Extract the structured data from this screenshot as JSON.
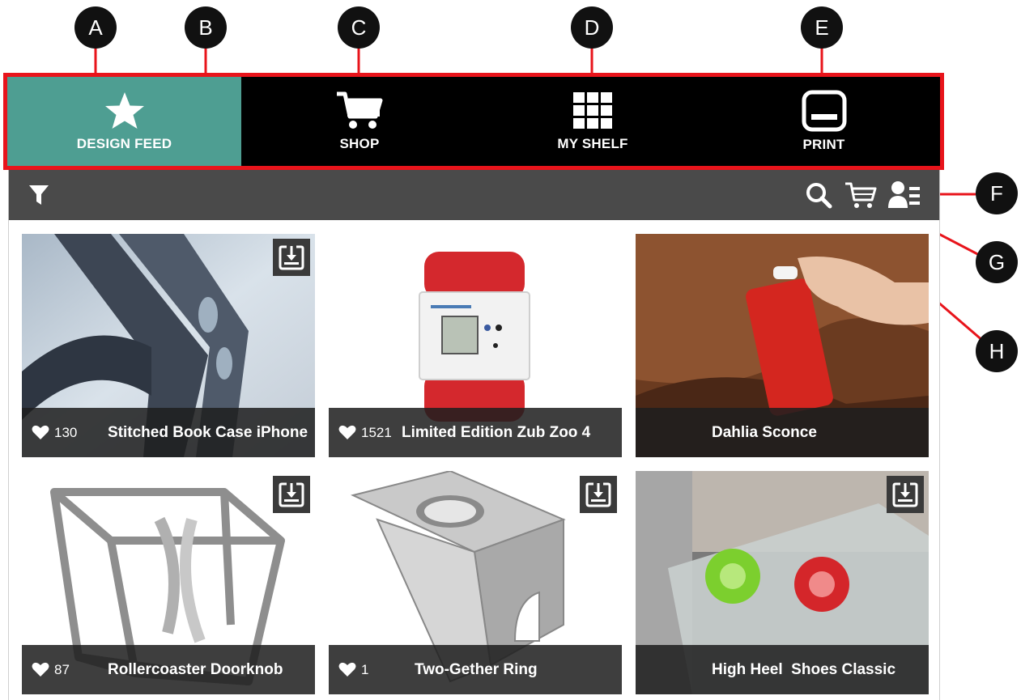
{
  "markers": [
    "A",
    "B",
    "C",
    "D",
    "E",
    "F",
    "G",
    "H"
  ],
  "nav": {
    "items": [
      {
        "label": "DESIGN FEED",
        "icon": "star-icon",
        "active": true
      },
      {
        "label": "SHOP",
        "icon": "cart-icon",
        "active": false
      },
      {
        "label": "MY SHELF",
        "icon": "grid-icon",
        "active": false
      },
      {
        "label": "PRINT",
        "icon": "printer-icon",
        "active": false
      }
    ],
    "active_color": "#4e9e92",
    "highlight_color": "#e8141b"
  },
  "toolbar": {
    "icons": [
      "filter-icon",
      "search-icon",
      "cart-icon",
      "profile-list-icon"
    ]
  },
  "feed": {
    "cards": [
      {
        "title": "Stitched Book Case iPhone",
        "likes": "130",
        "download": true
      },
      {
        "title": "Limited Edition Zub Zoo 4",
        "likes": "1521",
        "download": false
      },
      {
        "title": "Dahlia Sconce",
        "likes": "",
        "download": false
      },
      {
        "title": "Rollercoaster Doorknob",
        "likes": "87",
        "download": true
      },
      {
        "title": "Two-Gether Ring",
        "likes": "1",
        "download": true
      },
      {
        "title": "High Heel  Shoes Classic",
        "likes": "",
        "download": true
      }
    ]
  }
}
